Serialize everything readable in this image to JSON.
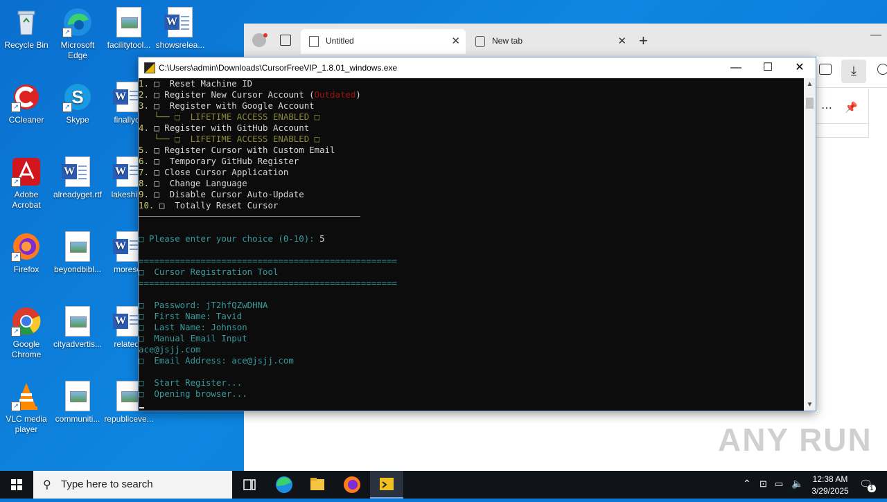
{
  "desktop": {
    "icons": [
      {
        "label": "Recycle Bin",
        "icon": "recycle-bin-icon"
      },
      {
        "label": "Microsoft Edge",
        "icon": "edge-icon"
      },
      {
        "label": "facilitytool...",
        "icon": "image-file-icon"
      },
      {
        "label": "showsrelea...",
        "icon": "word-doc-icon"
      },
      {
        "label": "CCleaner",
        "icon": "ccleaner-icon"
      },
      {
        "label": "Skype",
        "icon": "skype-icon"
      },
      {
        "label": "finallych",
        "icon": "word-doc-icon"
      },
      {
        "label": "Adobe Acrobat",
        "icon": "acrobat-icon"
      },
      {
        "label": "alreadyget.rtf",
        "icon": "word-doc-icon"
      },
      {
        "label": "lakeshipp",
        "icon": "word-doc-icon"
      },
      {
        "label": "Firefox",
        "icon": "firefox-icon"
      },
      {
        "label": "beyondbibl...",
        "icon": "image-file-icon"
      },
      {
        "label": "moresor",
        "icon": "word-doc-icon"
      },
      {
        "label": "Google Chrome",
        "icon": "chrome-icon"
      },
      {
        "label": "cityadvertis...",
        "icon": "image-file-icon"
      },
      {
        "label": "relatedp",
        "icon": "word-doc-icon"
      },
      {
        "label": "VLC media player",
        "icon": "vlc-icon"
      },
      {
        "label": "communiti...",
        "icon": "image-file-icon"
      },
      {
        "label": "republiceve...",
        "icon": "image-file-icon"
      }
    ]
  },
  "browser": {
    "tabs": [
      {
        "label": "Untitled"
      },
      {
        "label": "New tab"
      }
    ]
  },
  "console": {
    "title": "C:\\Users\\admin\\Downloads\\CursorFreeVIP_1.8.01_windows.exe",
    "menu": [
      {
        "num": "1.",
        "text": " □  Reset Machine ID"
      },
      {
        "num": "2.",
        "text": " □ Register New Cursor Account (",
        "warn": "Outdated",
        "tail": ")"
      },
      {
        "num": "3.",
        "text": " □  Register with Google Account"
      },
      {
        "sub": "   └── □  LIFETIME ACCESS ENABLED □"
      },
      {
        "num": "4.",
        "text": " □ Register with GitHub Account"
      },
      {
        "sub": "   └── □  LIFETIME ACCESS ENABLED □"
      },
      {
        "num": "5.",
        "text": " □ Register Cursor with Custom Email"
      },
      {
        "num": "6.",
        "text": " □  Temporary GitHub Register"
      },
      {
        "num": "7.",
        "text": " □ Close Cursor Application"
      },
      {
        "num": "8.",
        "text": " □  Change Language"
      },
      {
        "num": "9.",
        "text": " □  Disable Cursor Auto-Update"
      },
      {
        "num": "10.",
        "text": " □  Totally Reset Cursor"
      }
    ],
    "prompt": "□ Please enter your choice (0-10): ",
    "choice": "5",
    "rule": "==================================================",
    "tool_title": "□  Cursor Registration Tool",
    "lines": [
      "□  Password: jT2hfQZwDHNA",
      "□  First Name: Tavid",
      "□  Last Name: Johnson",
      "□  Manual Email Input"
    ],
    "email_echo": "ace@jsjj.com",
    "email_line": "□  Email Address: ace@jsjj.com",
    "status_lines": [
      "□  Start Register...",
      "□  Opening browser..."
    ]
  },
  "taskbar": {
    "search_placeholder": "Type here to search",
    "time": "12:38 AM",
    "date": "3/29/2025",
    "notification_count": "1"
  },
  "watermark": "ANY RUN"
}
